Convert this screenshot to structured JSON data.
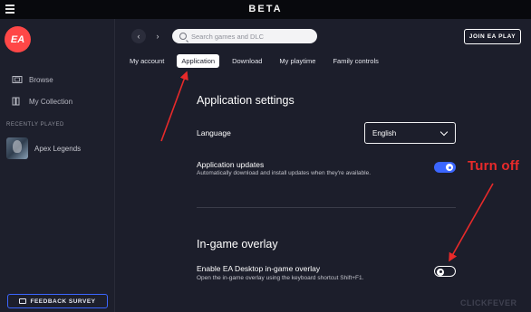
{
  "titlebar": {
    "title": "BETA"
  },
  "sidebar": {
    "logo": "EA",
    "items": [
      {
        "label": "Browse",
        "icon": "browse-icon"
      },
      {
        "label": "My Collection",
        "icon": "collection-icon"
      }
    ],
    "recently_played_label": "RECENTLY PLAYED",
    "recent_games": [
      {
        "name": "Apex Legends"
      }
    ],
    "feedback_label": "FEEDBACK SURVEY"
  },
  "topbar": {
    "search_placeholder": "Search games and DLC",
    "join_label": "JOIN EA PLAY"
  },
  "tabs": [
    {
      "label": "My account",
      "active": false
    },
    {
      "label": "Application",
      "active": true
    },
    {
      "label": "Download",
      "active": false
    },
    {
      "label": "My playtime",
      "active": false
    },
    {
      "label": "Family controls",
      "active": false
    }
  ],
  "application_settings": {
    "title": "Application settings",
    "language_label": "Language",
    "language_value": "English",
    "updates_label": "Application updates",
    "updates_desc": "Automatically download and install updates when they're available.",
    "updates_enabled": true
  },
  "overlay": {
    "title": "In-game overlay",
    "enable_label": "Enable EA Desktop in-game overlay",
    "enable_desc": "Open the in-game overlay using the keyboard shortcut Shift+F1.",
    "enabled": false
  },
  "annotation": {
    "text": "Turn off",
    "color": "#e82a2a"
  },
  "watermark": "CLICKFEVER",
  "colors": {
    "accent": "#3b66ff",
    "background": "#1c1e2b",
    "ea_red": "#ff4747"
  }
}
